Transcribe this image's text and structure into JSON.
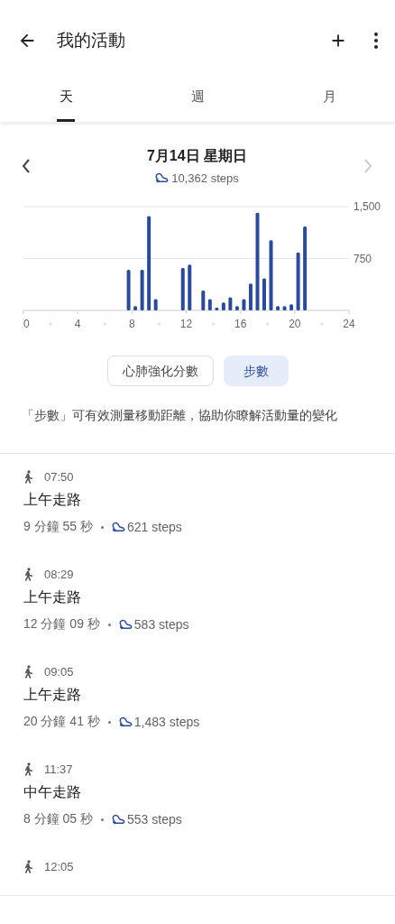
{
  "app_bar": {
    "title": "我的活動"
  },
  "tabs": [
    {
      "label": "天",
      "selected": true
    },
    {
      "label": "週",
      "selected": false
    },
    {
      "label": "月",
      "selected": false
    }
  ],
  "day": {
    "date": "7月14日 星期日",
    "total": "10,362 steps",
    "next_disabled": true
  },
  "chart_data": {
    "type": "bar",
    "x": [
      7.75,
      8.25,
      8.75,
      9.25,
      9.75,
      11.75,
      12.25,
      13.25,
      13.75,
      14.25,
      14.75,
      15.25,
      15.75,
      16.25,
      16.75,
      17.25,
      17.75,
      18.25,
      18.75,
      19.25,
      19.75,
      20.25,
      20.75
    ],
    "series": [
      {
        "color": "#2d4a94",
        "values": [
          575,
          50,
          575,
          1350,
          150,
          600,
          650,
          275,
          150,
          25,
          100,
          175,
          50,
          150,
          375,
          1400,
          450,
          1000,
          50,
          50,
          75,
          825,
          1200
        ]
      }
    ],
    "xlim": [
      0,
      24
    ],
    "ylim": [
      0,
      1500
    ],
    "xticks": [
      0,
      4,
      8,
      12,
      16,
      20,
      24
    ],
    "yticks": [
      {
        "value": 750,
        "label": "750"
      },
      {
        "value": 1500,
        "label": "1,500"
      }
    ]
  },
  "metrics": [
    {
      "label": "心肺強化分數",
      "selected": false
    },
    {
      "label": "步數",
      "selected": true
    }
  ],
  "description": "「步數」可有效測量移動距離，協助你瞭解活動量的變化",
  "activities": [
    {
      "time": "07:50",
      "title": "上午走路",
      "duration": "9 分鐘 55 秒",
      "steps": "621 steps"
    },
    {
      "time": "08:29",
      "title": "上午走路",
      "duration": "12 分鐘 09 秒",
      "steps": "583 steps"
    },
    {
      "time": "09:05",
      "title": "上午走路",
      "duration": "20 分鐘 41 秒",
      "steps": "1,483 steps"
    },
    {
      "time": "11:37",
      "title": "中午走路",
      "duration": "8 分鐘 05 秒",
      "steps": "553 steps"
    },
    {
      "time": "12:05"
    }
  ]
}
